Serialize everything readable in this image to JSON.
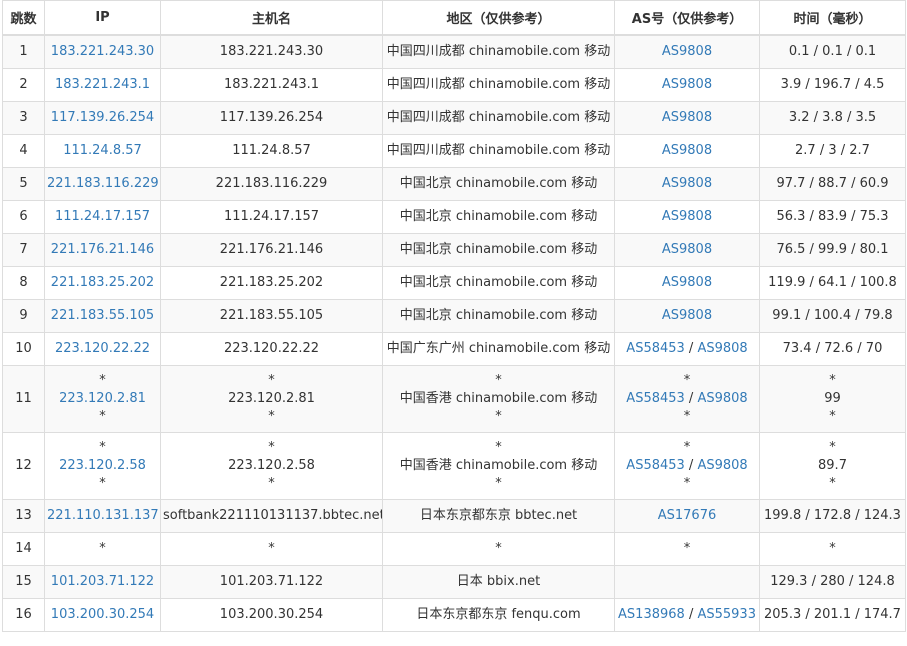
{
  "colors": {
    "link": "#337ab7",
    "border": "#dddddd",
    "stripe": "#f9f9f9",
    "text": "#333333"
  },
  "headers": [
    "跳数",
    "IP",
    "主机名",
    "地区（仅供参考）",
    "AS号（仅供参考）",
    "时间（毫秒）"
  ],
  "rows": [
    {
      "hop": "1",
      "ip": [
        "183.221.243.30"
      ],
      "host": [
        "183.221.243.30"
      ],
      "region": [
        "中国四川成都 chinamobile.com 移动"
      ],
      "as": [
        [
          "AS9808"
        ]
      ],
      "time": [
        "0.1 / 0.1 / 0.1"
      ]
    },
    {
      "hop": "2",
      "ip": [
        "183.221.243.1"
      ],
      "host": [
        "183.221.243.1"
      ],
      "region": [
        "中国四川成都 chinamobile.com 移动"
      ],
      "as": [
        [
          "AS9808"
        ]
      ],
      "time": [
        "3.9 / 196.7 / 4.5"
      ]
    },
    {
      "hop": "3",
      "ip": [
        "117.139.26.254"
      ],
      "host": [
        "117.139.26.254"
      ],
      "region": [
        "中国四川成都 chinamobile.com 移动"
      ],
      "as": [
        [
          "AS9808"
        ]
      ],
      "time": [
        "3.2 / 3.8 / 3.5"
      ]
    },
    {
      "hop": "4",
      "ip": [
        "111.24.8.57"
      ],
      "host": [
        "111.24.8.57"
      ],
      "region": [
        "中国四川成都 chinamobile.com 移动"
      ],
      "as": [
        [
          "AS9808"
        ]
      ],
      "time": [
        "2.7 / 3 / 2.7"
      ]
    },
    {
      "hop": "5",
      "ip": [
        "221.183.116.229"
      ],
      "host": [
        "221.183.116.229"
      ],
      "region": [
        "中国北京 chinamobile.com 移动"
      ],
      "as": [
        [
          "AS9808"
        ]
      ],
      "time": [
        "97.7 / 88.7 / 60.9"
      ]
    },
    {
      "hop": "6",
      "ip": [
        "111.24.17.157"
      ],
      "host": [
        "111.24.17.157"
      ],
      "region": [
        "中国北京 chinamobile.com 移动"
      ],
      "as": [
        [
          "AS9808"
        ]
      ],
      "time": [
        "56.3 / 83.9 / 75.3"
      ]
    },
    {
      "hop": "7",
      "ip": [
        "221.176.21.146"
      ],
      "host": [
        "221.176.21.146"
      ],
      "region": [
        "中国北京 chinamobile.com 移动"
      ],
      "as": [
        [
          "AS9808"
        ]
      ],
      "time": [
        "76.5 / 99.9 / 80.1"
      ]
    },
    {
      "hop": "8",
      "ip": [
        "221.183.25.202"
      ],
      "host": [
        "221.183.25.202"
      ],
      "region": [
        "中国北京 chinamobile.com 移动"
      ],
      "as": [
        [
          "AS9808"
        ]
      ],
      "time": [
        "119.9 / 64.1 / 100.8"
      ]
    },
    {
      "hop": "9",
      "ip": [
        "221.183.55.105"
      ],
      "host": [
        "221.183.55.105"
      ],
      "region": [
        "中国北京 chinamobile.com 移动"
      ],
      "as": [
        [
          "AS9808"
        ]
      ],
      "time": [
        "99.1 / 100.4 / 79.8"
      ]
    },
    {
      "hop": "10",
      "ip": [
        "223.120.22.22"
      ],
      "host": [
        "223.120.22.22"
      ],
      "region": [
        "中国广东广州 chinamobile.com 移动"
      ],
      "as": [
        [
          "AS58453",
          "AS9808"
        ]
      ],
      "time": [
        "73.4 / 72.6 / 70"
      ]
    },
    {
      "hop": "11",
      "ip": [
        "*",
        "223.120.2.81",
        "*"
      ],
      "host": [
        "*",
        "223.120.2.81",
        "*"
      ],
      "region": [
        "*",
        "中国香港 chinamobile.com 移动",
        "*"
      ],
      "as": [
        [
          "*"
        ],
        [
          "AS58453",
          "AS9808"
        ],
        [
          "*"
        ]
      ],
      "time": [
        "*",
        "99",
        "*"
      ]
    },
    {
      "hop": "12",
      "ip": [
        "*",
        "223.120.2.58",
        "*"
      ],
      "host": [
        "*",
        "223.120.2.58",
        "*"
      ],
      "region": [
        "*",
        "中国香港 chinamobile.com 移动",
        "*"
      ],
      "as": [
        [
          "*"
        ],
        [
          "AS58453",
          "AS9808"
        ],
        [
          "*"
        ]
      ],
      "time": [
        "*",
        "89.7",
        "*"
      ]
    },
    {
      "hop": "13",
      "ip": [
        "221.110.131.137"
      ],
      "host": [
        "softbank221110131137.bbtec.net"
      ],
      "region": [
        "日本东京都东京 bbtec.net"
      ],
      "as": [
        [
          "AS17676"
        ]
      ],
      "time": [
        "199.8 / 172.8 / 124.3"
      ]
    },
    {
      "hop": "14",
      "ip": [
        "*"
      ],
      "host": [
        "*"
      ],
      "region": [
        "*"
      ],
      "as": [
        [
          "*"
        ]
      ],
      "time": [
        "*"
      ]
    },
    {
      "hop": "15",
      "ip": [
        "101.203.71.122"
      ],
      "host": [
        "101.203.71.122"
      ],
      "region": [
        "日本 bbix.net"
      ],
      "as": [
        []
      ],
      "time": [
        "129.3 / 280 / 124.8"
      ]
    },
    {
      "hop": "16",
      "ip": [
        "103.200.30.254"
      ],
      "host": [
        "103.200.30.254"
      ],
      "region": [
        "日本东京都东京 fenqu.com"
      ],
      "as": [
        [
          "AS138968",
          "AS55933"
        ]
      ],
      "time": [
        "205.3 / 201.1 / 174.7"
      ]
    }
  ]
}
